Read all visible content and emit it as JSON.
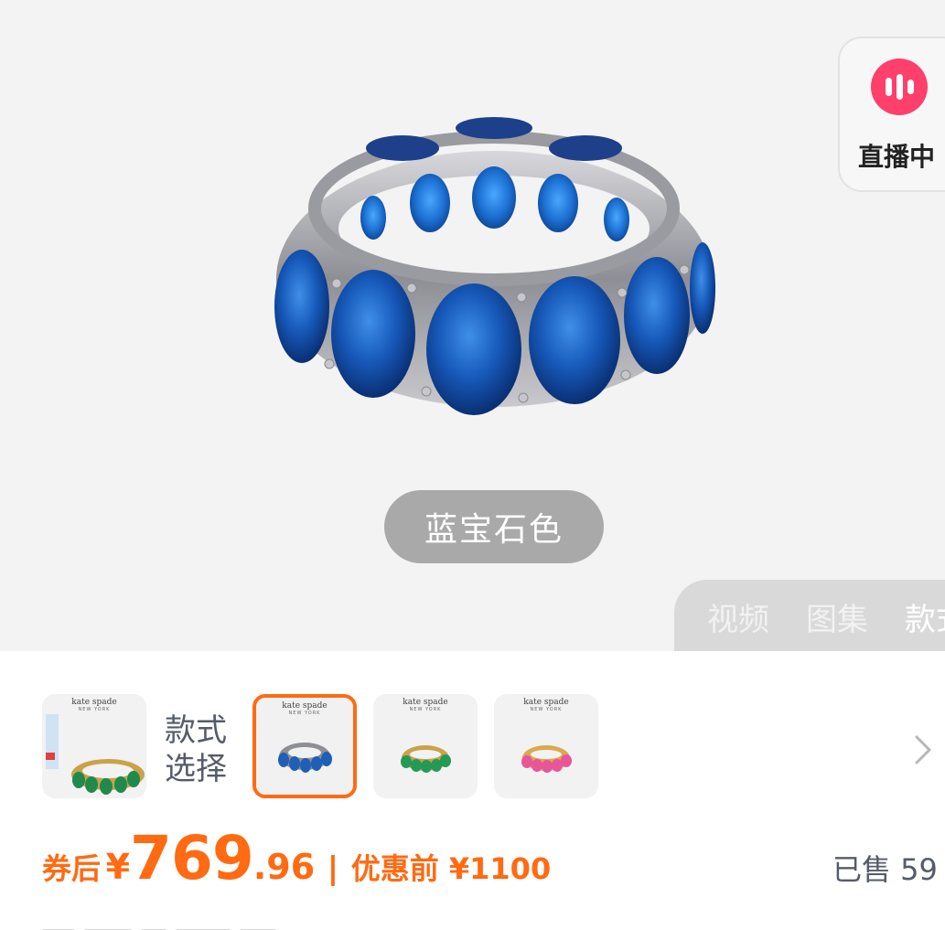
{
  "hero": {
    "variant_chip": "蓝宝石色",
    "live_badge": {
      "label": "直播中",
      "icon": "live-bars-icon",
      "color": "#ff3f6c"
    },
    "media_tabs": [
      {
        "label": "视频",
        "active": false
      },
      {
        "label": "图集",
        "active": false
      },
      {
        "label": "款式",
        "active": true
      }
    ]
  },
  "variants": {
    "label": "款式选择",
    "thumbnails": [
      {
        "brand": "kate spade",
        "brand_sub": "NEW YORK",
        "gem_color": "#1f8a4c",
        "selected": false
      },
      {
        "brand": "kate spade",
        "brand_sub": "NEW YORK",
        "gem_color": "#1f5fb5",
        "selected": true
      },
      {
        "brand": "kate spade",
        "brand_sub": "NEW YORK",
        "gem_color": "#239a55",
        "selected": false
      },
      {
        "brand": "kate spade",
        "brand_sub": "NEW YORK",
        "gem_color": "#e8559a",
        "selected": false
      }
    ],
    "more_icon": "chevron-right-icon"
  },
  "price": {
    "after_coupon_label": "券后",
    "currency": "¥",
    "integer": "769",
    "decimal": ".96",
    "separator": "|",
    "before_label": "优惠前 ¥1100",
    "accent_color": "#ff6a13"
  },
  "sales": {
    "label": "已售 59"
  }
}
